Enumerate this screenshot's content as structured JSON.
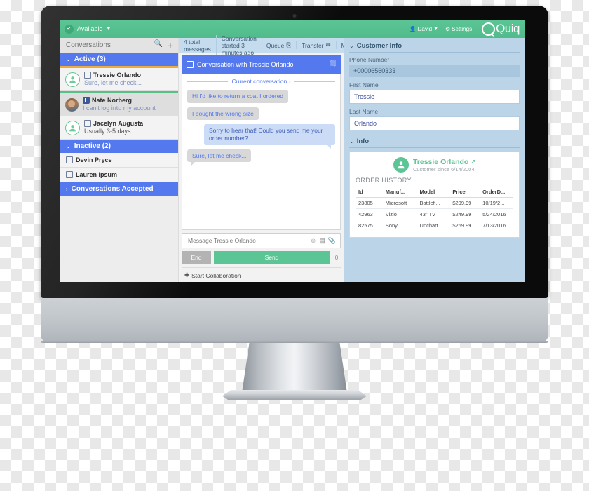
{
  "topbar": {
    "status_label": "Available",
    "status_icon": "check-circle-icon",
    "user_label": "David",
    "settings_label": "Settings",
    "brand_label": "Quiq"
  },
  "sidebar": {
    "header_title": "Conversations",
    "search_icon": "search-icon",
    "add_icon": "plus-icon",
    "sections": [
      {
        "label": "Active (3)",
        "items": [
          {
            "name": "Tressie Orlando",
            "preview": "Sure, let me check...",
            "channel": "sms-icon",
            "accent": "#f0a93c"
          },
          {
            "name": "Nate Norberg",
            "preview": "I can't log into my account",
            "channel": "facebook-icon",
            "accent": "#58bf86"
          },
          {
            "name": "Jacelyn Augusta",
            "preview": "Usually 3-5 days",
            "channel": "sms-icon",
            "accent": ""
          }
        ]
      },
      {
        "label": "Inactive (2)",
        "items": [
          {
            "name": "Devin Pryce",
            "channel": "sms-icon"
          },
          {
            "name": "Lauren Ipsum",
            "channel": "sms-icon"
          }
        ]
      },
      {
        "label": "Conversations Accepted",
        "items": []
      }
    ]
  },
  "conversation": {
    "meta_total": "4 total messages",
    "meta_started": "Conversation started 3 minutes ago",
    "actions": [
      {
        "label": "Queue",
        "icon": "queue-icon"
      },
      {
        "label": "Transfer",
        "icon": "transfer-icon"
      },
      {
        "label": "Mark Inactive",
        "icon": "close-icon"
      }
    ],
    "title": "Conversation with Tressie Orlando",
    "divider_label": "Current conversation ›",
    "messages": [
      {
        "direction": "in",
        "text": "Hi I'd like to return a coat I ordered"
      },
      {
        "direction": "in",
        "text": "I bought the wrong size"
      },
      {
        "direction": "out",
        "text": "Sorry to hear that! Could you send me your order number?"
      },
      {
        "direction": "in",
        "text": "Sure, let me check..."
      }
    ]
  },
  "composer": {
    "placeholder": "Message Tressie Orlando",
    "value": "",
    "icons": [
      "emoji-icon",
      "snippet-icon",
      "attachment-icon"
    ],
    "end_label": "End",
    "send_label": "Send",
    "char_count": "0",
    "collaboration_label": "Start Collaboration"
  },
  "customer_panel": {
    "section_title": "Customer Info",
    "fields": [
      {
        "label": "Phone Number",
        "value": "+00006560333",
        "readonly": true
      },
      {
        "label": "First Name",
        "value": "Tressie",
        "readonly": false
      },
      {
        "label": "Last Name",
        "value": "Orlando",
        "readonly": false
      }
    ],
    "info_title": "Info",
    "customer_name": "Tressie Orlando",
    "external_link_icon": "external-link-icon",
    "customer_since": "Customer since 6/14/2004",
    "order_history_title": "ORDER HISTORY",
    "order_columns": [
      "Id",
      "Manuf...",
      "Model",
      "Price",
      "OrderD..."
    ],
    "orders": [
      [
        "23805",
        "Microsoft",
        "Battlefi...",
        "$299.99",
        "10/19/2..."
      ],
      [
        "42963",
        "Vizio",
        "43\" TV",
        "$249.99",
        "5/24/2016"
      ],
      [
        "82575",
        "Sony",
        "Unchart...",
        "$269.99",
        "7/13/2016"
      ]
    ]
  },
  "colors": {
    "brand_green": "#5cc595",
    "section_blue": "#5479ef",
    "panel_blue": "#bcd4e8",
    "meta_blue": "#c5dcef",
    "accent_orange": "#f0a93c"
  }
}
